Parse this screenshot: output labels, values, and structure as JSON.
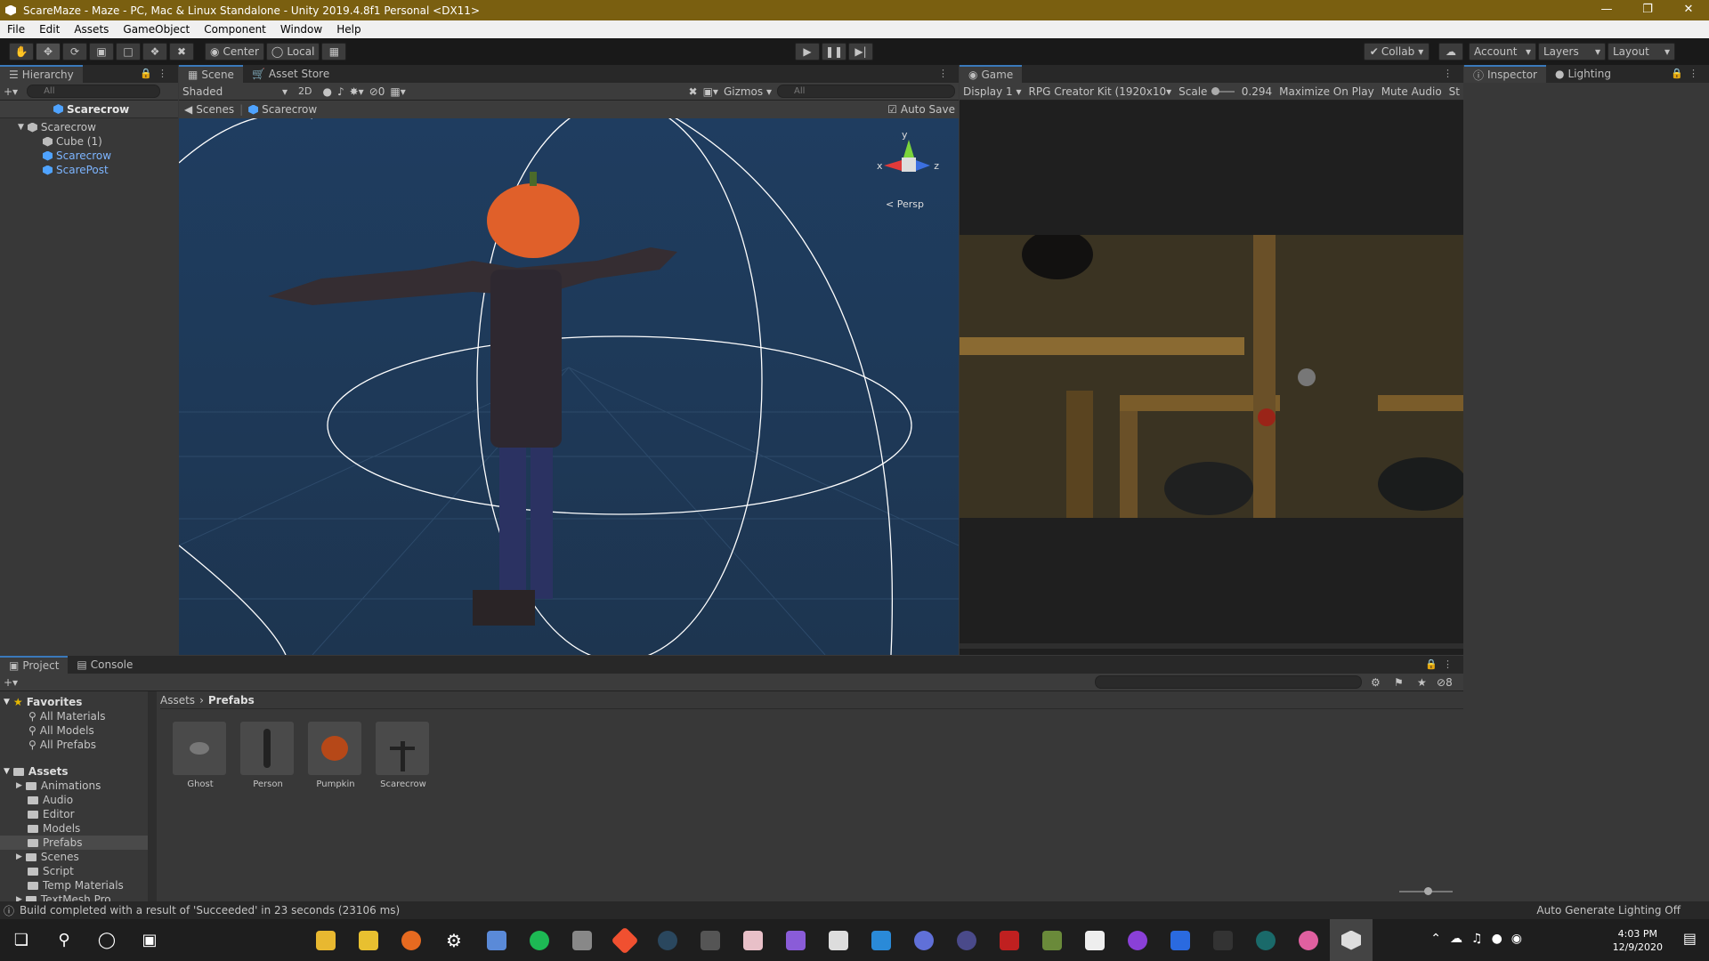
{
  "window": {
    "title": "ScareMaze - Maze - PC, Mac & Linux Standalone - Unity 2019.4.8f1 Personal <DX11>"
  },
  "menu": [
    "File",
    "Edit",
    "Assets",
    "GameObject",
    "Component",
    "Window",
    "Help"
  ],
  "toolbar": {
    "pivot_label": "Center",
    "space_label": "Local",
    "collab_label": "Collab",
    "account_label": "Account",
    "layers_label": "Layers",
    "layout_label": "Layout"
  },
  "hierarchy": {
    "tab": "Hierarchy",
    "search_placeholder": "All",
    "scene": "Scarecrow",
    "root": "Scarecrow",
    "children": [
      "Cube (1)",
      "Scarecrow",
      "ScarePost"
    ]
  },
  "scene": {
    "tab_scene": "Scene",
    "tab_asset_store": "Asset Store",
    "shading": "Shaded",
    "mode_2d": "2D",
    "hidden_count": "0",
    "gizmos": "Gizmos",
    "search_placeholder": "All",
    "breadcrumb_root": "Scenes",
    "breadcrumb_item": "Scarecrow",
    "auto_save": "Auto Save",
    "persp": "Persp",
    "axis_y": "y",
    "axis_x": "x",
    "axis_z": "z"
  },
  "game": {
    "tab": "Game",
    "display": "Display 1",
    "resolution": "RPG Creator Kit (1920x10",
    "scale_label": "Scale",
    "scale_value": "0.294",
    "maximize": "Maximize On Play",
    "mute": "Mute Audio",
    "stats": "St"
  },
  "inspector": {
    "tab_inspector": "Inspector",
    "tab_lighting": "Lighting"
  },
  "project": {
    "tab_project": "Project",
    "tab_console": "Console",
    "favorites_title": "Favorites",
    "favorites": [
      "All Materials",
      "All Models",
      "All Prefabs"
    ],
    "assets_title": "Assets",
    "folders": [
      "Animations",
      "Audio",
      "Editor",
      "Models",
      "Prefabs",
      "Scenes",
      "Script",
      "Temp Materials",
      "TextMesh Pro"
    ],
    "breadcrumb_root": "Assets",
    "breadcrumb_item": "Prefabs",
    "hidden_count": "8",
    "prefabs": [
      {
        "name": "Ghost"
      },
      {
        "name": "Person"
      },
      {
        "name": "Pumpkin"
      },
      {
        "name": "Scarecrow"
      }
    ]
  },
  "status": {
    "message": "Build completed with a result of 'Succeeded' in 23 seconds (23106 ms)",
    "right": "Auto Generate Lighting Off"
  },
  "taskbar": {
    "time": "4:03 PM",
    "date": "12/9/2020"
  },
  "colors": {
    "scene_bg": "#1f3a5a",
    "accent": "#3a79bb",
    "title_bar": "#7a5f10"
  }
}
